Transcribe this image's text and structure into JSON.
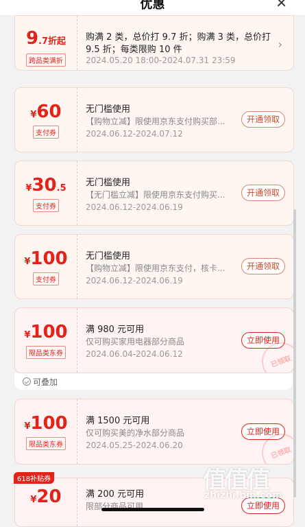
{
  "header": {
    "title": "优惠",
    "close_glyph": "✕"
  },
  "colors": {
    "accent": "#e2231a",
    "card_bg": "#fff6f2"
  },
  "coupons": [
    {
      "amount": "9",
      "amount_decimal": ".7",
      "amount_unit": "折起",
      "tag": "跨品类满折",
      "line1": "购满 2 类，总价打 9.7 折；购满 3 类，总价打",
      "line1b": "9.5 折；每类限购 10 件",
      "dates": "2024.05.20 18:00-2024.07.31 23:59"
    },
    {
      "currency": "¥",
      "amount": "60",
      "tag": "支付券",
      "line1": "无门槛使用",
      "line2": "【购物立减】限使用京东支付购买部...",
      "dates": "2024.06.12-2024.07.12",
      "button": "开通领取"
    },
    {
      "currency": "¥",
      "amount": "30",
      "amount_decimal": ".5",
      "tag": "支付券",
      "line1": "无门槛使用",
      "line2": "【无门槛立减】限使用京东支付购买...",
      "dates": "2024.06.12-2024.06.19",
      "button": "开通领取"
    },
    {
      "currency": "¥",
      "amount": "100",
      "tag": "支付券",
      "line1": "无门槛使用",
      "line2": "【购物立减】限使用京东支付，核卡...",
      "dates": "2024.06.12-2024.06.19",
      "button": "开通领取"
    },
    {
      "currency": "¥",
      "amount": "100",
      "tag": "限品类东券",
      "line1": "满 980 元可用",
      "line2": "仅可购买家用电器部分商品",
      "dates": "2024.06.04-2024.06.12",
      "button": "立即使用",
      "stamp": "已领取"
    },
    {
      "currency": "¥",
      "amount": "100",
      "tag": "限品类东券",
      "line1": "满 1500 元可用",
      "line2": "仅可购买美的净水部分商品",
      "dates": "2024.05.25-2024.06.20",
      "button": "立即使用",
      "stamp": "已领取"
    },
    {
      "currency": "¥",
      "amount": "20",
      "badge": "618补贴券",
      "line1": "满 200 元可用",
      "line2": "限部分商品可用",
      "button": "立即使用"
    }
  ],
  "stackable": {
    "label": "可叠加",
    "icon": "check-circle-icon"
  },
  "watermark": {
    "big": "值值值",
    "small": "zhizhi.bin.com"
  }
}
